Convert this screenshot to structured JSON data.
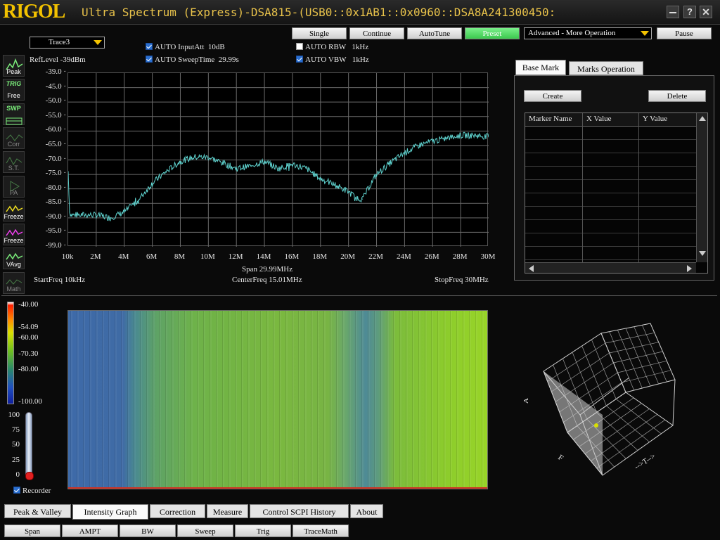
{
  "window": {
    "brand": "RIGOL",
    "title": "Ultra Spectrum (Express)-DSA815-(USB0::0x1AB1::0x0960::DSA8A241300450:",
    "controls": [
      "minimize",
      "help",
      "close"
    ]
  },
  "sidebar": [
    {
      "top": "",
      "label": "Peak",
      "icon": "peak-icon",
      "active": true
    },
    {
      "top": "TRIG",
      "label": "Free",
      "icon": "trig-free-icon",
      "active": true
    },
    {
      "top": "SWP",
      "label": "",
      "icon": "sweep-icon",
      "active": true
    },
    {
      "top": "",
      "label": "Corr",
      "icon": "corr-icon",
      "active": false
    },
    {
      "top": "",
      "label": "S.T.",
      "icon": "st-icon",
      "active": false
    },
    {
      "top": "",
      "label": "PA",
      "icon": "pa-icon",
      "active": false
    },
    {
      "top": "",
      "label": "Freeze",
      "icon": "freeze-yellow-icon",
      "active": true
    },
    {
      "top": "",
      "label": "Freeze",
      "icon": "freeze-magenta-icon",
      "active": true
    },
    {
      "top": "",
      "label": "VAvg",
      "icon": "vavg-icon",
      "active": true
    },
    {
      "top": "",
      "label": "Math",
      "icon": "math-icon",
      "active": false
    }
  ],
  "trace_select": "Trace3",
  "ref_level": "RefLevel  -39dBm",
  "settings": {
    "input_att": {
      "label": "AUTO InputAtt",
      "value": "10dB",
      "checked": true
    },
    "sweep_time": {
      "label": "AUTO SweepTime",
      "value": "29.99s",
      "checked": true
    },
    "rbw": {
      "label": "AUTO RBW",
      "value": "1kHz",
      "checked": false
    },
    "vbw": {
      "label": "AUTO VBW",
      "value": "1kHz",
      "checked": true
    }
  },
  "toolbar": {
    "single": "Single",
    "continue": "Continue",
    "autotune": "AutoTune",
    "preset": "Preset",
    "mode_select": "Advanced - More Operation",
    "pause": "Pause"
  },
  "freq_info": {
    "span": "Span  29.99MHz",
    "start": "StartFreq  10kHz",
    "center": "CenterFreq  15.01MHz",
    "stop": "StopFreq  30MHz"
  },
  "marker_panel": {
    "tabs": [
      "Base Mark",
      "Marks Operation"
    ],
    "create": "Create",
    "delete": "Delete",
    "columns": [
      "Marker Name",
      "X Value",
      "Y Value"
    ]
  },
  "intensity": {
    "scale_labels": [
      "-40.00",
      "-54.09",
      "-60.00",
      "-70.30",
      "-80.00",
      "-100.00"
    ],
    "percent_labels": [
      "100",
      "75",
      "50",
      "25",
      "0"
    ],
    "recorder": "Recorder",
    "recorder_checked": true
  },
  "axes3d": {
    "f_label": "F",
    "t_label": "-->T-->",
    "a_label": "A"
  },
  "bottom_tabs": [
    "Peak & Valley",
    "Intensity Graph",
    "Correction",
    "Measure",
    "Control SCPI History",
    "About"
  ],
  "bottom_active_tab": "Intensity Graph",
  "bottom_buttons": [
    "Span",
    "AMPT",
    "BW",
    "Sweep",
    "Trig",
    "TraceMath"
  ],
  "colors": {
    "trace": "#5fd3cf",
    "grid": "#6a6a6a",
    "preset": "#4ad25a",
    "brand": "#f3c200"
  },
  "chart_data": {
    "type": "line",
    "title": "",
    "xlabel": "",
    "ylabel": "",
    "xlim": [
      0,
      30
    ],
    "ylim": [
      -99,
      -39
    ],
    "x_ticks": [
      "10k",
      "2M",
      "4M",
      "6M",
      "8M",
      "10M",
      "12M",
      "14M",
      "16M",
      "18M",
      "20M",
      "22M",
      "24M",
      "26M",
      "28M",
      "30M"
    ],
    "y_ticks": [
      "-39.0",
      "-45.0",
      "-50.0",
      "-55.0",
      "-60.0",
      "-65.0",
      "-70.0",
      "-75.0",
      "-80.0",
      "-85.0",
      "-90.0",
      "-95.0",
      "-99.0"
    ],
    "grid": true,
    "series": [
      {
        "name": "",
        "x": [
          0,
          0.1,
          0.2,
          1,
          2,
          3,
          4,
          5,
          6,
          7,
          8,
          9,
          10,
          11,
          12,
          13,
          14,
          15,
          16,
          17,
          18,
          19,
          20,
          20.5,
          21,
          21.5,
          22,
          23,
          24,
          25,
          26,
          27,
          28,
          29,
          30
        ],
        "values": [
          -73,
          -87,
          -88,
          -88,
          -88,
          -89,
          -87,
          -83,
          -77,
          -73,
          -69.5,
          -68,
          -68,
          -70,
          -72,
          -71,
          -69.5,
          -72,
          -70.5,
          -72,
          -75.5,
          -77.5,
          -80,
          -82,
          -82.5,
          -78,
          -74,
          -70,
          -66.5,
          -64,
          -62.5,
          -61.5,
          -60.5,
          -60.5,
          -61
        ]
      }
    ]
  }
}
